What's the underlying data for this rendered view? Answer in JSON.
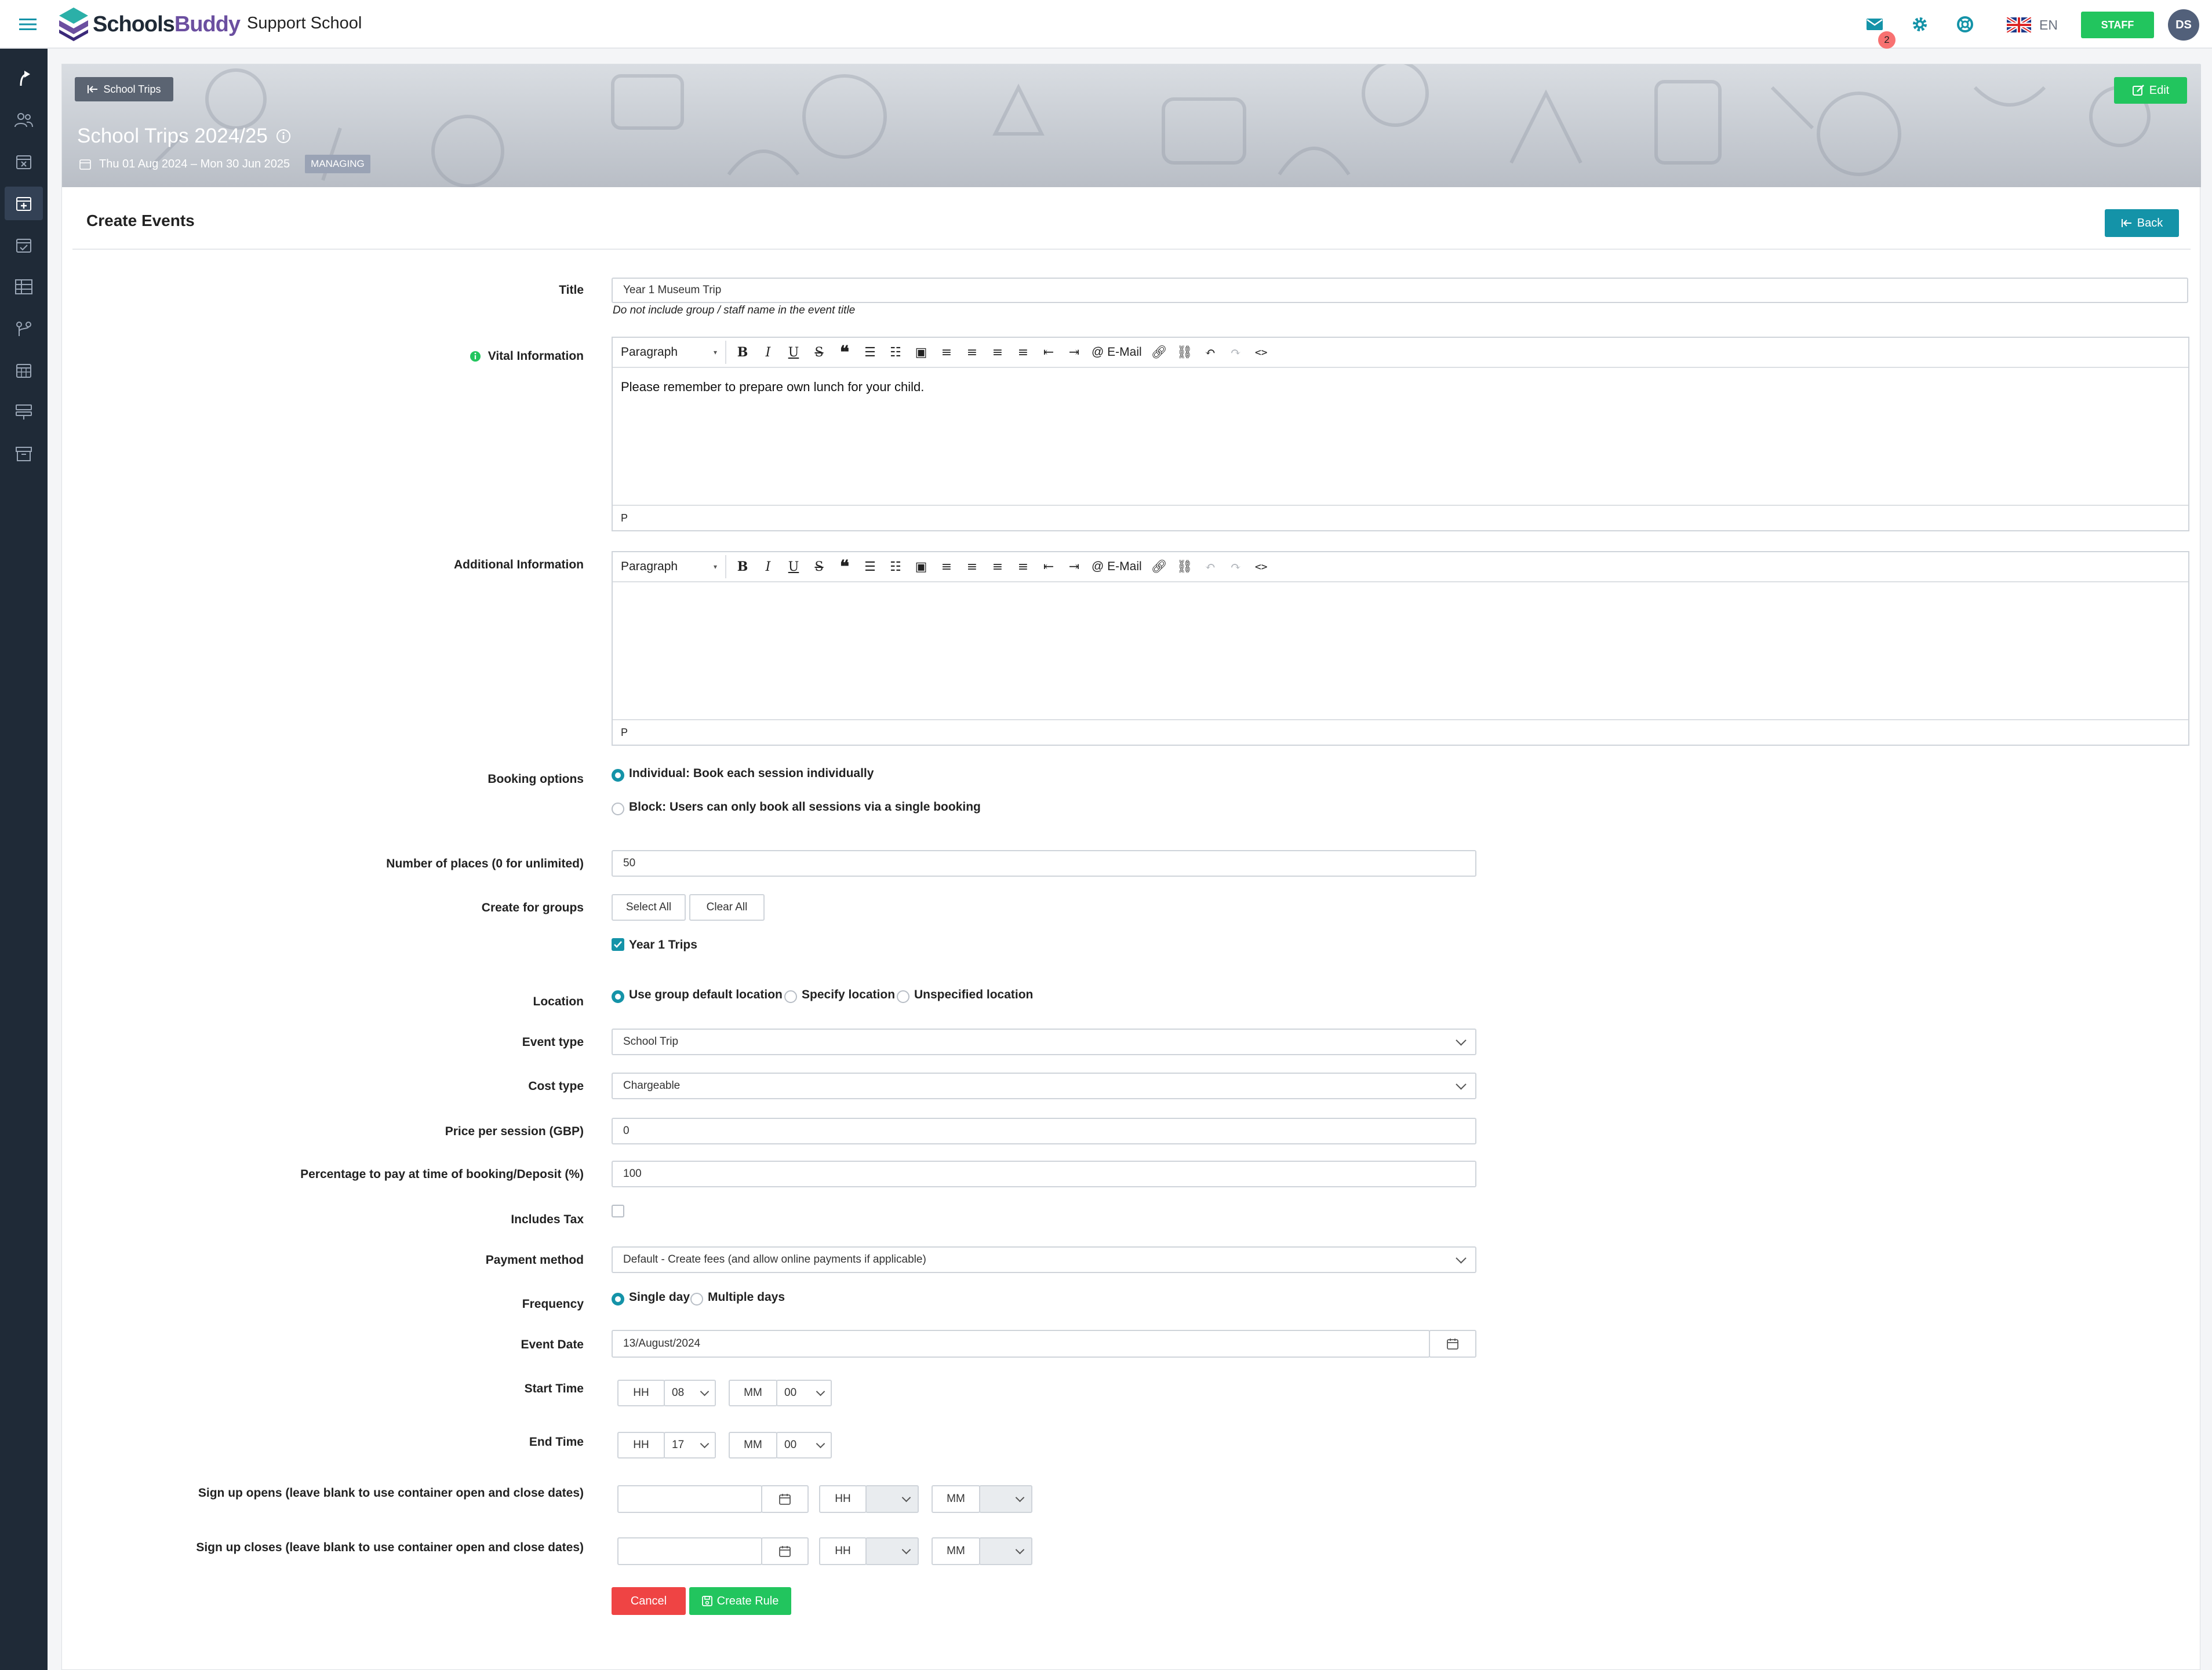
{
  "topbar": {
    "brand_schools": "Schools",
    "brand_buddy": "Buddy",
    "school_name": "Support School",
    "mail_badge": "2",
    "language": "EN",
    "role_badge": "STAFF",
    "avatar_initials": "DS"
  },
  "sidebar": {
    "items": [
      "share",
      "users",
      "calendar-x",
      "calendar-plus",
      "calendar-check",
      "table",
      "route",
      "calendar-grid",
      "layers",
      "archive"
    ]
  },
  "banner": {
    "back_label": "School Trips",
    "edit_label": "Edit",
    "title": "School Trips 2024/25",
    "dates": "Thu 01 Aug 2024 – Mon 30 Jun 2025",
    "status_badge": "MANAGING"
  },
  "panel": {
    "title": "Create Events",
    "back_label": "Back"
  },
  "form": {
    "title_label": "Title",
    "title_value": "Year 1 Museum Trip",
    "title_hint": "Do not include group / staff name in the event title",
    "vital_label": "Vital Information",
    "vital_text": "Please remember to prepare own lunch for your child.",
    "additional_label": "Additional Information",
    "editor_format": "Paragraph",
    "editor_email": "E-Mail",
    "editor_status": "P",
    "booking_label": "Booking options",
    "booking_individual": "Individual: Book each session individually",
    "booking_block": "Block: Users can only book all sessions via a single booking",
    "places_label": "Number of places (0 for unlimited)",
    "places_value": "50",
    "groups_label": "Create for groups",
    "select_all": "Select All",
    "clear_all": "Clear All",
    "group_year1": "Year 1 Trips",
    "location_label": "Location",
    "location_default": "Use group default location",
    "location_specify": "Specify location",
    "location_unspecified": "Unspecified location",
    "event_type_label": "Event type",
    "event_type_value": "School Trip",
    "cost_type_label": "Cost type",
    "cost_type_value": "Chargeable",
    "price_label": "Price per session (GBP)",
    "price_value": "0",
    "deposit_label": "Percentage to pay at time of booking/Deposit (%)",
    "deposit_value": "100",
    "tax_label": "Includes Tax",
    "payment_label": "Payment method",
    "payment_value": "Default - Create fees (and allow online payments if applicable)",
    "frequency_label": "Frequency",
    "freq_single": "Single day",
    "freq_multiple": "Multiple days",
    "event_date_label": "Event Date",
    "event_date_value": "13/August/2024",
    "start_label": "Start Time",
    "end_label": "End Time",
    "hh": "HH",
    "mm": "MM",
    "start_hh": "08",
    "start_mm": "00",
    "end_hh": "17",
    "end_mm": "00",
    "signup_opens_label": "Sign up opens (leave blank to use container open and close dates)",
    "signup_closes_label": "Sign up closes (leave blank to use container open and close dates)",
    "cancel_label": "Cancel",
    "create_label": "Create Rule"
  },
  "colors": {
    "teal": "#1493a8",
    "green": "#22c55e",
    "red": "#ef4444",
    "sidebar": "#1f2a37",
    "brand_purple": "#6b4fa0"
  }
}
